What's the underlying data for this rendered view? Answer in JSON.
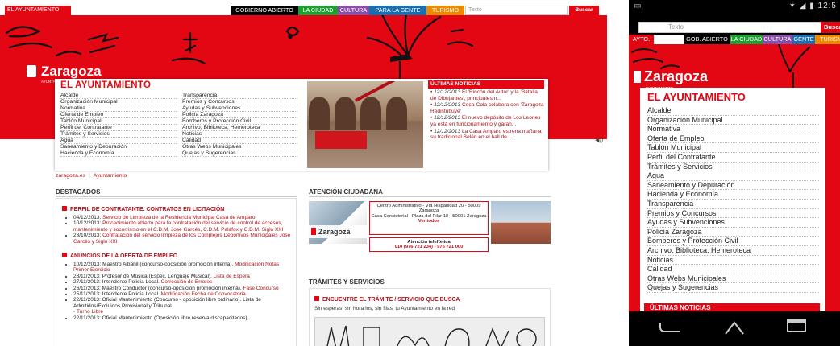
{
  "desktop": {
    "top": {
      "ayto_tab": "EL AYUNTAMIENTO",
      "tabs": [
        "GOBIERNO ABIERTO",
        "LA CIUDAD",
        "CULTURA",
        "PARA LA GENTE",
        "TURISMO"
      ],
      "search_placeholder": "Texto",
      "search_button": "Buscar"
    },
    "logo": {
      "name": "Zaragoza",
      "sub": "AYUNTAMIENTO"
    },
    "panel": {
      "title": "EL AYUNTAMIENTO",
      "col1": [
        "Alcalde",
        "Organización Municipal",
        "Normativa",
        "Oferta de Empleo",
        "Tablón Municipal",
        "Perfil del Contratante",
        "Trámites y Servicios",
        "Agua",
        "Saneamiento y Depuración",
        "Hacienda y Economía"
      ],
      "col2": [
        "Transparencia",
        "Premios y Concursos",
        "Ayudas y Subvenciones",
        "Policía Zaragoza",
        "Bomberos y Protección Civil",
        "Archivo, Biblioteca, Hemeroteca",
        "Noticias",
        "Calidad",
        "Otras Webs Municipales",
        "Quejas y Sugerencias"
      ]
    },
    "news": {
      "title": "ÚLTIMAS NOTICIAS",
      "items": [
        {
          "date": "12/12/2013",
          "text": "El 'Rincón del Autor' y la 'Batalla de Dibujantes', principales n..."
        },
        {
          "date": "12/12/2013",
          "text": "Coca-Cola colabora con 'Zaragoza Redistribuye'"
        },
        {
          "date": "12/12/2013",
          "text": "El nuevo depósito de Los Leones ya está en funcionamiento y garan..."
        },
        {
          "date": "12/12/2013",
          "text": "La Casa Amparo estrena mañana su tradicional Belén en el hall de ..."
        }
      ]
    },
    "breadcrumb": [
      "zaragoza.es",
      "Ayuntamiento"
    ],
    "destacados": {
      "title": "DESTACADOS",
      "sec1": {
        "title": "PERFIL DE CONTRATANTE. CONTRATOS EN LICITACIÓN",
        "items": [
          {
            "lead": "04/12/2013: ",
            "link": "Servicio de Limpieza de la Residencia Municipal Casa de Amparo"
          },
          {
            "lead": "10/12/2013: ",
            "link": "Procedimiento abierto para la contratación del servicio de control de accesos, mantenimiento y socorrismo en el C.D.M. José Garcés, C.D.M. Palafox y C.D.M. Siglo XXI"
          },
          {
            "lead": "23/10/2013: ",
            "link": "Contratación del servicio limpieza de los Complejos Deportivos Municipales José Garcés y Siglo XXI"
          }
        ]
      },
      "sec2": {
        "title": "ANUNCIOS DE LA OFERTA DE EMPLEO",
        "items": [
          {
            "lead": "10/12/2013: Maestro Albañil (concurso-oposición promoción interna). ",
            "link": "Modificación Notas Primer Ejercicio"
          },
          {
            "lead": "28/11/2013: Profesor de Música (Espec. Lenguaje Musical). ",
            "link": "Lista de Espera"
          },
          {
            "lead": "27/11/2013: Intendente Policía Local. ",
            "link": "Corrección de Errores"
          },
          {
            "lead": "26/11/2013: Maestro Conductor (concurso-oposición promoción interna). ",
            "link": "Fase Concurso"
          },
          {
            "lead": "25/11/2013: Intendente Policía Local. ",
            "link": "Modificación Fecha de Convocatoria"
          },
          {
            "lead": "22/11/2013: Oficial Mantenimiento (Concurso - oposición libre ordinario). Lista de Admitidos/Excluidos Provisional y Tribunal",
            "link": "Turno Libre"
          },
          {
            "lead": "22/11/2013: Oficial Mantenimiento (Oposición libre reserva discapacitados).",
            "link": ""
          }
        ]
      }
    },
    "atencion": {
      "title": "ATENCIÓN CIUDADANA",
      "photo_text": "Zaragoza",
      "addr1": "Centro Administrativo - Vía Hispanidad 20 - 50009 Zaragoza",
      "addr2": "Casa Consistorial - Plaza del Pilar 18 - 50001 Zaragoza",
      "ver_todos": "Ver todos",
      "tel_label": "Atención telefónica",
      "tel_num": "010 (976 721 234) - 976 721 000"
    },
    "tramites": {
      "title": "TRÁMITES Y SERVICIOS",
      "box_title": "ENCUENTRE EL TRÁMITE / SERVICIO QUE BUSCA",
      "desc": "Sin esperas, sin horarios, sin filas, tu Ayuntamiento en la red"
    }
  },
  "phone": {
    "status_time": "12:5",
    "search_placeholder": "Texto",
    "search_button": "Buscar",
    "nav": [
      "AYTO.",
      "GOB. ABIERTO",
      "LA CIUDAD",
      "CULTURA",
      "GENTE",
      "TURISM"
    ],
    "logo": {
      "name": "Zaragoza",
      "sub": "AYUNTAMIENTO"
    },
    "panel_title": "EL AYUNTAMIENTO",
    "list": [
      "Alcalde",
      "Organización Municipal",
      "Normativa",
      "Oferta de Empleo",
      "Tablón Municipal",
      "Perfil del Contratante",
      "Trámites y Servicios",
      "Agua",
      "Saneamiento y Depuración",
      "Hacienda y Economía",
      "Transparencia",
      "Premios y Concursos",
      "Ayudas y Subvenciones",
      "Policía Zaragoza",
      "Bomberos y Protección Civil",
      "Archivo, Biblioteca, Hemeroteca",
      "Noticias",
      "Calidad",
      "Otras Webs Municipales",
      "Quejas y Sugerencias"
    ],
    "news_title": "ÚLTIMAS NOTICIAS"
  },
  "colors": {
    "brand_red": "#e30613",
    "gob_black": "#000000",
    "ciudad_green": "#1f9e32",
    "cultura_purple": "#8a4fa6",
    "gente_blue": "#1a6fb3",
    "turismo_orange": "#ef8a00"
  }
}
